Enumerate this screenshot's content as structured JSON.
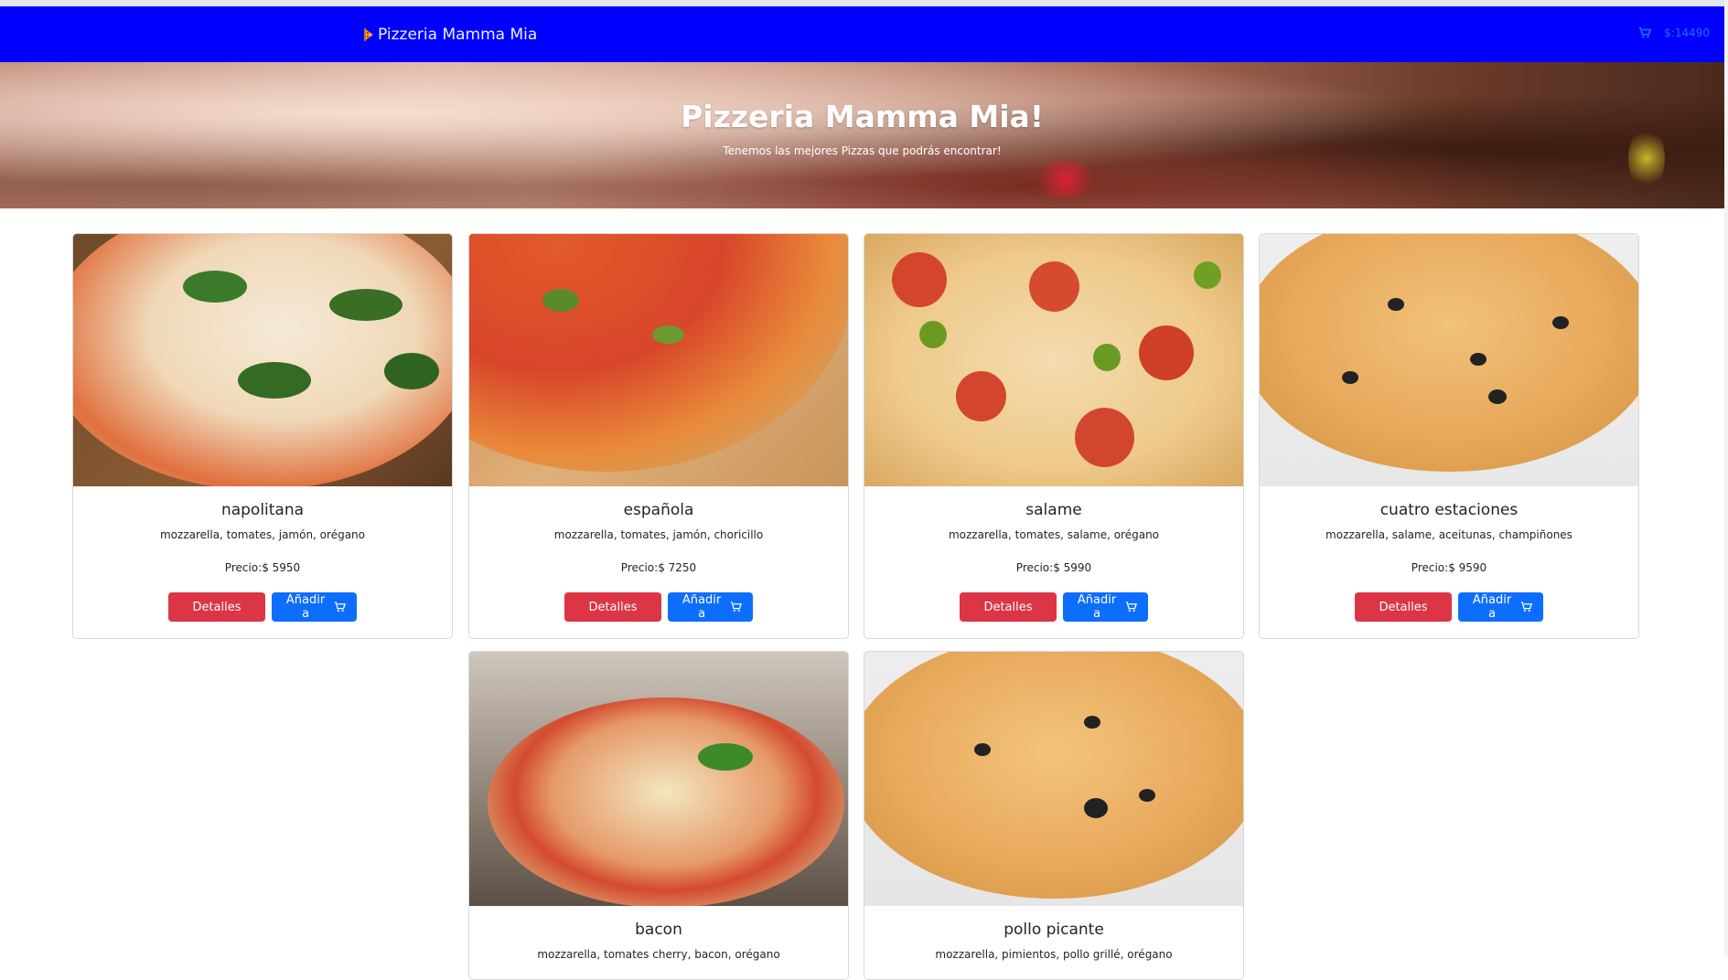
{
  "nav": {
    "brand": "Pizzeria Mamma Mia",
    "total": "$:14490"
  },
  "hero": {
    "title": "Pizzeria Mamma Mia!",
    "subtitle": "Tenemos las mejores Pizzas que podrás encontrar!"
  },
  "labels": {
    "details": "Detalles",
    "add": "Añadir a"
  },
  "pizzas": [
    {
      "name": "napolitana",
      "ingredients": "mozzarella, tomates, jamón, orégano",
      "price": "Precio:$ 5950"
    },
    {
      "name": "española",
      "ingredients": "mozzarella, tomates, jamón, choricillo",
      "price": "Precio:$ 7250"
    },
    {
      "name": "salame",
      "ingredients": "mozzarella, tomates, salame, orégano",
      "price": "Precio:$ 5990"
    },
    {
      "name": "cuatro estaciones",
      "ingredients": "mozzarella, salame, aceitunas, champiñones",
      "price": "Precio:$ 9590"
    },
    {
      "name": "bacon",
      "ingredients": "mozzarella, tomates cherry, bacon, orégano",
      "price": ""
    },
    {
      "name": "pollo picante",
      "ingredients": "mozzarella, pimientos, pollo grillé, orégano",
      "price": ""
    }
  ],
  "colors": {
    "navbar": "#0000ff",
    "details_button": "#dc3545",
    "add_button": "#0d6efd"
  }
}
